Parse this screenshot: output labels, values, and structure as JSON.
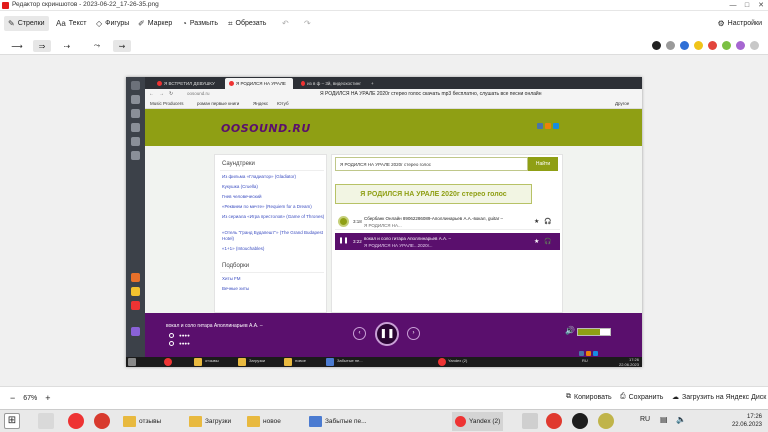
{
  "window": {
    "title": "Редактор скриншотов - 2023-06-22_17-26-35.png",
    "controls": [
      "—",
      "□",
      "✕"
    ]
  },
  "toolbar": {
    "tools": [
      {
        "name": "arrows",
        "label": "Стрелки",
        "icon": "✎",
        "active": true
      },
      {
        "name": "text",
        "label": "Текст",
        "icon": "Aa"
      },
      {
        "name": "shapes",
        "label": "Фигуры",
        "icon": "◇"
      },
      {
        "name": "marker",
        "label": "Маркер",
        "icon": "✐"
      },
      {
        "name": "blur",
        "label": "Размыть",
        "icon": "◔"
      },
      {
        "name": "crop",
        "label": "Обрезать",
        "icon": "⌗"
      }
    ],
    "undo": "↶",
    "redo": "↷",
    "settings_label": "Настройки"
  },
  "subtoolbar": {
    "strokes": [
      "⟶",
      "⇒",
      "⇢",
      "⤳",
      "⇝"
    ],
    "colors": [
      "#222222",
      "#9a9a9a",
      "#2f6fd6",
      "#f0c419",
      "#e2453c",
      "#7bc043",
      "#a666d1",
      "#c8c8c8"
    ]
  },
  "browser": {
    "tabs": [
      {
        "label": "Я ВСТРЕТИЛ ДЕВУШКУ"
      },
      {
        "label": "Я РОДИЛСЯ НА УРАЛЕ",
        "active": true
      },
      {
        "label": "из в ф – 3й, видеохостинг"
      }
    ],
    "url": "oosound.ru",
    "page_title": "Я РОДИЛСЯ НА УРАЛЕ 2020г стерео голос скачать mp3 бесплатно, слушать все песни онлайн",
    "bookmarks": [
      "Music Producers",
      "роман первые книги",
      "Яндекс",
      "Ютуб"
    ],
    "other_label": "Другое"
  },
  "site": {
    "logo": "OOSOUND.RU",
    "left": {
      "heading1": "Саундтреки",
      "links": [
        "Из фильма «Гладиатор» (Gladiator)",
        "Кукушка (Cruella)",
        "Гнев человеческий",
        "«Реквием по мечте» (Requiem for a Dream)",
        "Из сериала «Игра престолов» (Game of Thrones)",
        "«Отель \"Гранд Будапешт\"» (The Grand Budapest Hotel)",
        "«1+1» (Intouchables)"
      ],
      "heading2": "Подборки",
      "links2": [
        "Хиты FM",
        "Вечные хиты"
      ]
    },
    "search": {
      "value": "Я РОДИЛСЯ НА УРАЛЕ 2020г стерео голос",
      "button": "Найти"
    },
    "headline": "Я РОДИЛСЯ НА УРАЛЕ 2020г стерео голос",
    "tracks": [
      {
        "duration": "3:18",
        "title": "Сбербанк Онлайн 89062286089-Аполлинарьев А.А.-вокал, guitar –",
        "subtitle": "Я РОДИЛСЯ НА...",
        "playing": false
      },
      {
        "duration": "3:22",
        "title": "вокал и соло гитара Аполлинарьев А.А. –",
        "subtitle": "Я РОДИЛСЯ НА УРАЛЕ...2020г...",
        "playing": true
      }
    ]
  },
  "player": {
    "now_playing": "вокал и соло гитара Аполлинарьев А.А. –",
    "line2": "●●●●",
    "line3": "●●●●",
    "prev": "‹",
    "pause": "❚❚",
    "next": "›",
    "volume_icon": "🔊",
    "volume_fraction": 0.7
  },
  "inner_taskbar": {
    "items": [
      "отзывы",
      "Загрузки",
      "новое",
      "Забытые пе...",
      "Yandex (2)"
    ],
    "clock_time": "17:26",
    "clock_date": "22.06.2023",
    "lang": "RU"
  },
  "statusbar": {
    "zoom_minus": "−",
    "zoom": "67%",
    "zoom_plus": "+",
    "copy": "Копировать",
    "save": "Сохранить",
    "upload": "Загрузить на Яндекс Диск"
  },
  "taskbar": {
    "apps": [
      {
        "label": "отзывы"
      },
      {
        "label": "Загрузки"
      },
      {
        "label": "новое"
      },
      {
        "label": "Забытые пе..."
      },
      {
        "label": "Yandex (2)",
        "active": true
      }
    ],
    "lang": "RU",
    "time": "17:26",
    "date": "22.06.2023"
  }
}
